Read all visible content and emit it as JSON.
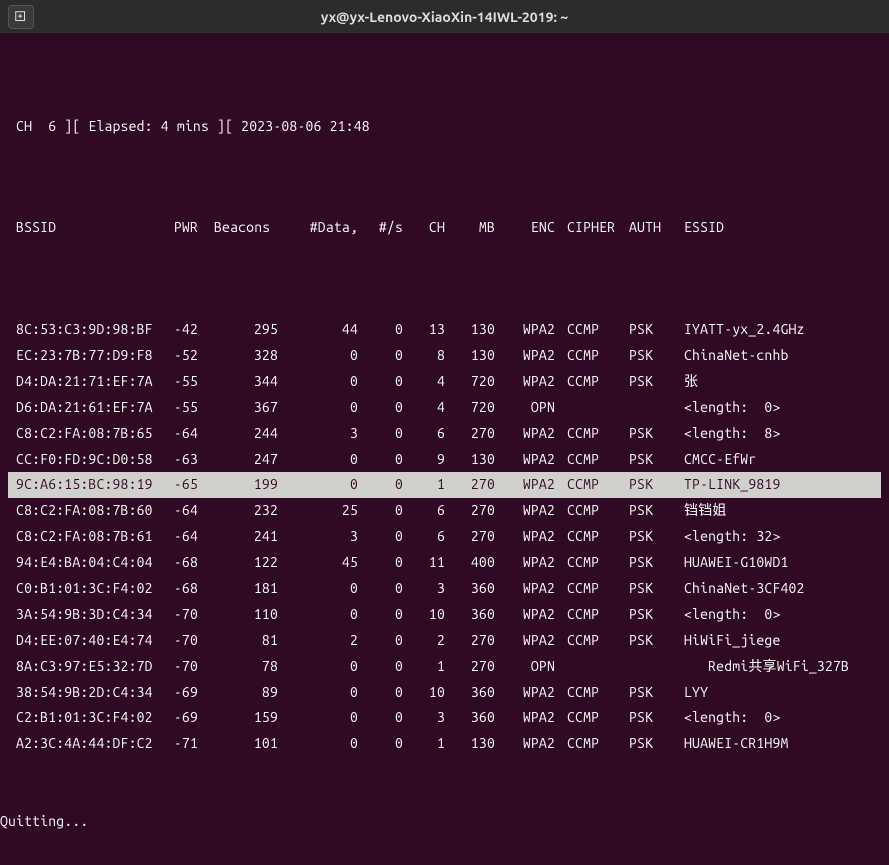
{
  "window": {
    "title": "yx@yx-Lenovo-XiaoXin-14IWL-2019: ~"
  },
  "status": " CH  6 ][ Elapsed: 4 mins ][ 2023-08-06 21:48",
  "headers": {
    "bssid": " BSSID",
    "pwr": "PWR",
    "beacons": "Beacons",
    "data": "#Data,",
    "ns": "#/s",
    "ch": "CH",
    "mb": "MB",
    "enc": "ENC",
    "cipher": "CIPHER",
    "auth": "AUTH",
    "essid": "ESSID"
  },
  "rows": [
    {
      "bssid": " 8C:53:C3:9D:98:BF",
      "pwr": "-42",
      "beacons": "295",
      "data": "44",
      "ns": "0",
      "ch": "13",
      "mb": "130",
      "enc": "WPA2",
      "cipher": "CCMP",
      "auth": "PSK",
      "essid": "IYATT-yx_2.4GHz",
      "hl": false
    },
    {
      "bssid": " EC:23:7B:77:D9:F8",
      "pwr": "-52",
      "beacons": "328",
      "data": "0",
      "ns": "0",
      "ch": "8",
      "mb": "130",
      "enc": "WPA2",
      "cipher": "CCMP",
      "auth": "PSK",
      "essid": "ChinaNet-cnhb",
      "hl": false
    },
    {
      "bssid": " D4:DA:21:71:EF:7A",
      "pwr": "-55",
      "beacons": "344",
      "data": "0",
      "ns": "0",
      "ch": "4",
      "mb": "720",
      "enc": "WPA2",
      "cipher": "CCMP",
      "auth": "PSK",
      "essid": "张",
      "hl": false
    },
    {
      "bssid": " D6:DA:21:61:EF:7A",
      "pwr": "-55",
      "beacons": "367",
      "data": "0",
      "ns": "0",
      "ch": "4",
      "mb": "720",
      "enc": "OPN",
      "cipher": "",
      "auth": "",
      "essid": "<length:  0>",
      "hl": false
    },
    {
      "bssid": " C8:C2:FA:08:7B:65",
      "pwr": "-64",
      "beacons": "244",
      "data": "3",
      "ns": "0",
      "ch": "6",
      "mb": "270",
      "enc": "WPA2",
      "cipher": "CCMP",
      "auth": "PSK",
      "essid": "<length:  8>",
      "hl": false
    },
    {
      "bssid": " CC:F0:FD:9C:D0:58",
      "pwr": "-63",
      "beacons": "247",
      "data": "0",
      "ns": "0",
      "ch": "9",
      "mb": "130",
      "enc": "WPA2",
      "cipher": "CCMP",
      "auth": "PSK",
      "essid": "CMCC-EfWr",
      "hl": false
    },
    {
      "bssid": " 9C:A6:15:BC:98:19",
      "pwr": "-65",
      "beacons": "199",
      "data": "0",
      "ns": "0",
      "ch": "1",
      "mb": "270",
      "enc": "WPA2",
      "cipher": "CCMP",
      "auth": "PSK",
      "essid": "TP-LINK_9819",
      "hl": true
    },
    {
      "bssid": " C8:C2:FA:08:7B:60",
      "pwr": "-64",
      "beacons": "232",
      "data": "25",
      "ns": "0",
      "ch": "6",
      "mb": "270",
      "enc": "WPA2",
      "cipher": "CCMP",
      "auth": "PSK",
      "essid": "铛铛姐",
      "hl": false
    },
    {
      "bssid": " C8:C2:FA:08:7B:61",
      "pwr": "-64",
      "beacons": "241",
      "data": "3",
      "ns": "0",
      "ch": "6",
      "mb": "270",
      "enc": "WPA2",
      "cipher": "CCMP",
      "auth": "PSK",
      "essid": "<length: 32>",
      "hl": false
    },
    {
      "bssid": " 94:E4:BA:04:C4:04",
      "pwr": "-68",
      "beacons": "122",
      "data": "45",
      "ns": "0",
      "ch": "11",
      "mb": "400",
      "enc": "WPA2",
      "cipher": "CCMP",
      "auth": "PSK",
      "essid": "HUAWEI-G10WD1",
      "hl": false
    },
    {
      "bssid": " C0:B1:01:3C:F4:02",
      "pwr": "-68",
      "beacons": "181",
      "data": "0",
      "ns": "0",
      "ch": "3",
      "mb": "360",
      "enc": "WPA2",
      "cipher": "CCMP",
      "auth": "PSK",
      "essid": "ChinaNet-3CF402",
      "hl": false
    },
    {
      "bssid": " 3A:54:9B:3D:C4:34",
      "pwr": "-70",
      "beacons": "110",
      "data": "0",
      "ns": "0",
      "ch": "10",
      "mb": "360",
      "enc": "WPA2",
      "cipher": "CCMP",
      "auth": "PSK",
      "essid": "<length:  0>",
      "hl": false
    },
    {
      "bssid": " D4:EE:07:40:E4:74",
      "pwr": "-70",
      "beacons": "81",
      "data": "2",
      "ns": "0",
      "ch": "2",
      "mb": "270",
      "enc": "WPA2",
      "cipher": "CCMP",
      "auth": "PSK",
      "essid": "HiWiFi_jiege",
      "hl": false
    },
    {
      "bssid": " 8A:C3:97:E5:32:7D",
      "pwr": "-70",
      "beacons": "78",
      "data": "0",
      "ns": "0",
      "ch": "1",
      "mb": "270",
      "enc": "OPN",
      "cipher": "",
      "auth": "",
      "essid": "   Redmi共享WiFi_327B",
      "hl": false
    },
    {
      "bssid": " 38:54:9B:2D:C4:34",
      "pwr": "-69",
      "beacons": "89",
      "data": "0",
      "ns": "0",
      "ch": "10",
      "mb": "360",
      "enc": "WPA2",
      "cipher": "CCMP",
      "auth": "PSK",
      "essid": "LYY",
      "hl": false
    },
    {
      "bssid": " C2:B1:01:3C:F4:02",
      "pwr": "-69",
      "beacons": "159",
      "data": "0",
      "ns": "0",
      "ch": "3",
      "mb": "360",
      "enc": "WPA2",
      "cipher": "CCMP",
      "auth": "PSK",
      "essid": "<length:  0>",
      "hl": false
    },
    {
      "bssid": " A2:3C:4A:44:DF:C2",
      "pwr": "-71",
      "beacons": "101",
      "data": "0",
      "ns": "0",
      "ch": "1",
      "mb": "130",
      "enc": "WPA2",
      "cipher": "CCMP",
      "auth": "PSK",
      "essid": "HUAWEI-CR1H9M",
      "hl": false
    }
  ],
  "footer": "Quitting...",
  "highlight_index": 6
}
